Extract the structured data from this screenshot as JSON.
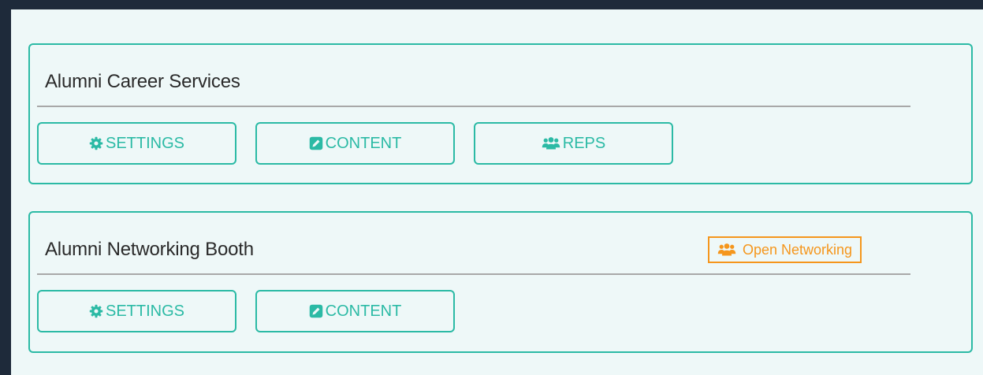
{
  "colors": {
    "background": "#1e2a3a",
    "panel": "#eef8f8",
    "accent": "#2bbaa5",
    "badge": "#f5961c",
    "divider": "#a8a8a8",
    "title": "#2a2a2a"
  },
  "booths": [
    {
      "title": "Alumni Career Services",
      "buttons": [
        {
          "label": "SETTINGS",
          "icon": "gear-icon"
        },
        {
          "label": "CONTENT",
          "icon": "edit-icon"
        },
        {
          "label": "REPS",
          "icon": "users-icon"
        }
      ]
    },
    {
      "title": "Alumni Networking Booth",
      "badge": {
        "label": "Open Networking",
        "icon": "users-icon"
      },
      "buttons": [
        {
          "label": "SETTINGS",
          "icon": "gear-icon"
        },
        {
          "label": "CONTENT",
          "icon": "edit-icon"
        }
      ]
    }
  ]
}
